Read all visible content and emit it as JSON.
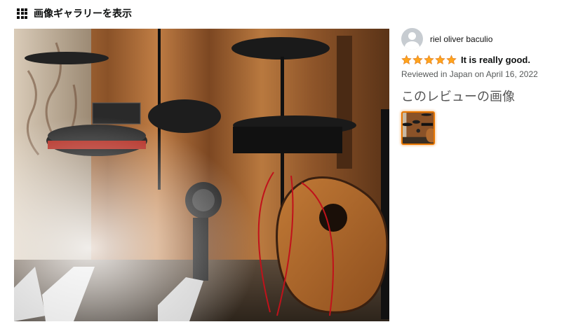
{
  "header": {
    "icon": "grid-icon",
    "title": "画像ギャラリーを表示"
  },
  "review": {
    "reviewer_name": "riel oliver baculio",
    "rating": 5,
    "rating_max": 5,
    "title": "It is really good.",
    "meta": "Reviewed in Japan on April 16, 2022",
    "images_heading": "このレビューの画像",
    "thumbnail_count": 1
  },
  "colors": {
    "star": "#ffa41c",
    "thumb_border": "#e77600",
    "meta_text": "#565959"
  }
}
